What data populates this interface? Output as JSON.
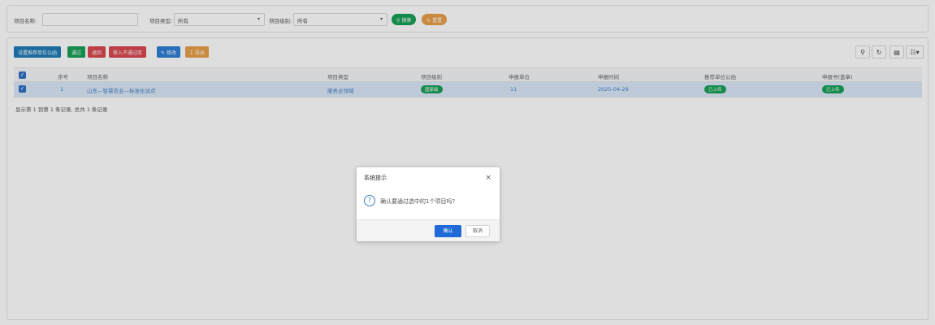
{
  "search": {
    "name_label": "项目名称:",
    "name_value": "",
    "type_label": "项目类型:",
    "type_value": "所有",
    "level_label": "项目级别:",
    "level_value": "所有",
    "search_button": "搜索",
    "reset_button": "重置"
  },
  "toolbar": {
    "buttons": [
      "设置推荐单位公函",
      "通过",
      "退回",
      "移入不通过库",
      "修改",
      "导出"
    ],
    "icons": [
      "search-icon",
      "refresh-icon",
      "columns-icon",
      "grid-icon"
    ]
  },
  "table": {
    "headers": [
      "序号",
      "项目名称",
      "项目类型",
      "项目级别",
      "申报单位",
      "申报时间",
      "推荐单位公函",
      "申报书(盖章)"
    ],
    "rows": [
      {
        "index": "1",
        "name": "山东—智慧农业—标准化试点",
        "type": "服务业领域",
        "level": "国家级",
        "unit": "11",
        "date": "2025-04-29",
        "letter": "已上传",
        "application": "已上传"
      }
    ],
    "summary": "显示第 1 到第 1 条记录, 总共 1 条记录"
  },
  "dialog": {
    "title": "系统提示",
    "message": "确认要通过选中的1个项目吗?",
    "confirm": "确认",
    "cancel": "取消"
  },
  "colors": {
    "search_button": "#18a058",
    "reset_button": "#e8a04a",
    "set_letter_button": "#1f7bb8",
    "pass_button": "#18a058",
    "return_button": "#d9484f",
    "reject_button": "#d9484f",
    "edit_button": "#2f7fd6",
    "export_button": "#e8a04a",
    "badge": "#18a058",
    "confirm_button": "#1f6ad6"
  }
}
